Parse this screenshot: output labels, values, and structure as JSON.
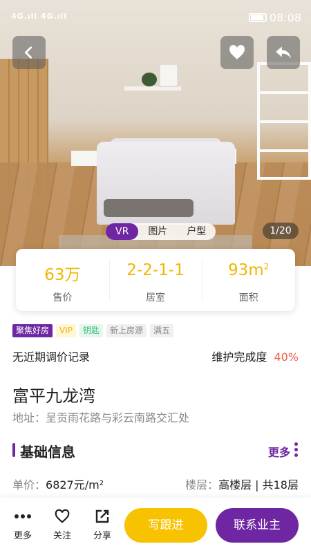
{
  "status_bar": {
    "signal": "4G.ıll 4G.ıll",
    "time": "08:08"
  },
  "gallery": {
    "tabs": [
      {
        "label": "VR",
        "active": true
      },
      {
        "label": "图片",
        "active": false
      },
      {
        "label": "户型",
        "active": false
      }
    ],
    "counter": "1/20"
  },
  "stats": {
    "price": {
      "value": "63万",
      "label": "售价"
    },
    "layout": {
      "value": "2-2-1-1",
      "label": "居室"
    },
    "area": {
      "value": "93m",
      "unit_sup": "2",
      "label": "面积"
    }
  },
  "tags": [
    "聚焦好房",
    "VIP",
    "钥匙",
    "新上房源",
    "满五"
  ],
  "price_history": "无近期调价记录",
  "maintenance": {
    "label": "维护完成度",
    "value": "40%"
  },
  "estate": {
    "name": "富平九龙湾",
    "address": "地址：呈贡雨花路与彩云南路交汇处"
  },
  "basic_info": {
    "title": "基础信息",
    "more": "更多",
    "unit_price_label": "单价：",
    "unit_price_value": "6827元/m²",
    "floor_label": "楼层：",
    "floor_value": "高楼层 | 共18层"
  },
  "bottom_bar": {
    "more": "更多",
    "follow": "关注",
    "share": "分享",
    "followup_button": "写跟进",
    "contact_button": "联系业主"
  },
  "colors": {
    "brand": "#6f26a3",
    "accent": "#f7c300",
    "stat_value": "#f2b600",
    "warning": "#f25c4a"
  }
}
